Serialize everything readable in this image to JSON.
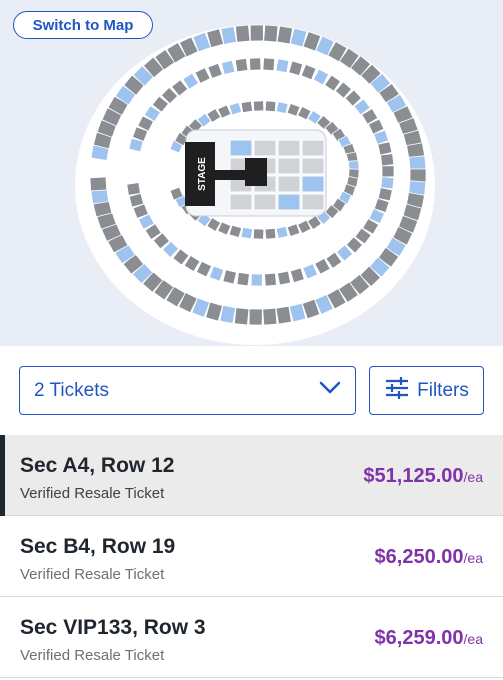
{
  "map": {
    "switch_label": "Switch to Map",
    "stage_label": "STAGE",
    "colors": {
      "available": "#9fc3ef",
      "unavailable": "#8a8d91",
      "stage": "#1f1f1f",
      "bg": "#e9edf5"
    }
  },
  "controls": {
    "quantity_value": "2 Tickets",
    "filters_label": "Filters",
    "accent": "#1f56c4"
  },
  "listings": [
    {
      "section": "Sec A4, Row 12",
      "type": "Verified Resale Ticket",
      "price": "$51,125.00",
      "unit": "/ea",
      "selected": true
    },
    {
      "section": "Sec B4, Row 19",
      "type": "Verified Resale Ticket",
      "price": "$6,250.00",
      "unit": "/ea",
      "selected": false
    },
    {
      "section": "Sec VIP133, Row 3",
      "type": "Verified Resale Ticket",
      "price": "$6,259.00",
      "unit": "/ea",
      "selected": false
    }
  ],
  "price_color": "#8033a8"
}
